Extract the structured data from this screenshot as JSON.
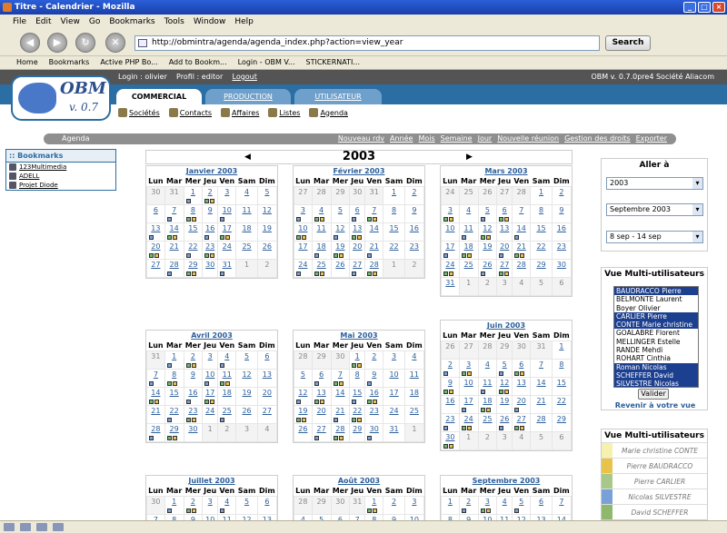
{
  "window": {
    "title": "Titre - Calendrier - Mozilla"
  },
  "menu": [
    "File",
    "Edit",
    "View",
    "Go",
    "Bookmarks",
    "Tools",
    "Window",
    "Help"
  ],
  "url": "http://obmintra/agenda/agenda_index.php?action=view_year",
  "search_label": "Search",
  "bookmark_bar": [
    "Home",
    "Bookmarks",
    "Active PHP Bo...",
    "Add to Bookm...",
    "Login - OBM V...",
    "STICKERNATI..."
  ],
  "topstrip": {
    "login": "Login : olivier",
    "profil": "Profil : editor",
    "logout": "Logout",
    "version": "OBM v. 0.7.0pre4 Société Aliacom"
  },
  "logo": {
    "name": "OBM",
    "version": "v. 0.7"
  },
  "tabs": [
    "COMMERCIAL",
    "PRODUCTION",
    "UTILISATEUR"
  ],
  "subnav": [
    "Sociétés",
    "Contacts",
    "Affaires",
    "Listes",
    "Agenda"
  ],
  "agendabar": {
    "label": "Agenda",
    "links": [
      "Nouveau rdv",
      "Année",
      "Mois",
      "Semaine",
      "Jour",
      "Nouvelle réunion",
      "Gestion des droits",
      "Exporter"
    ]
  },
  "bookmarks": {
    "title": ":: Bookmarks",
    "items": [
      "123Multimedia",
      "ADELL",
      "Projet Diode"
    ]
  },
  "year": "2003",
  "dow": [
    "Lun",
    "Mar",
    "Mer",
    "Jeu",
    "Ven",
    "Sam",
    "Dim"
  ],
  "months": [
    {
      "name": "Janvier 2003",
      "weeks": [
        [
          "30",
          "31",
          "1",
          "2",
          "3",
          "4",
          "5"
        ],
        [
          "6",
          "7",
          "8",
          "9",
          "10",
          "11",
          "12"
        ],
        [
          "13",
          "14",
          "15",
          "16",
          "17",
          "18",
          "19"
        ],
        [
          "20",
          "21",
          "22",
          "23",
          "24",
          "25",
          "26"
        ],
        [
          "27",
          "28",
          "29",
          "30",
          "31",
          "1",
          "2"
        ]
      ]
    },
    {
      "name": "Février 2003",
      "weeks": [
        [
          "27",
          "28",
          "29",
          "30",
          "31",
          "1",
          "2"
        ],
        [
          "3",
          "4",
          "5",
          "6",
          "7",
          "8",
          "9"
        ],
        [
          "10",
          "11",
          "12",
          "13",
          "14",
          "15",
          "16"
        ],
        [
          "17",
          "18",
          "19",
          "20",
          "21",
          "22",
          "23"
        ],
        [
          "24",
          "25",
          "26",
          "27",
          "28",
          "1",
          "2"
        ]
      ]
    },
    {
      "name": "Mars 2003",
      "weeks": [
        [
          "24",
          "25",
          "26",
          "27",
          "28",
          "1",
          "2"
        ],
        [
          "3",
          "4",
          "5",
          "6",
          "7",
          "8",
          "9"
        ],
        [
          "10",
          "11",
          "12",
          "13",
          "14",
          "15",
          "16"
        ],
        [
          "17",
          "18",
          "19",
          "20",
          "21",
          "22",
          "23"
        ],
        [
          "24",
          "25",
          "26",
          "27",
          "28",
          "29",
          "30"
        ],
        [
          "31",
          "1",
          "2",
          "3",
          "4",
          "5",
          "6"
        ]
      ]
    },
    {
      "name": "Avril 2003",
      "weeks": [
        [
          "31",
          "1",
          "2",
          "3",
          "4",
          "5",
          "6"
        ],
        [
          "7",
          "8",
          "9",
          "10",
          "11",
          "12",
          "13"
        ],
        [
          "14",
          "15",
          "16",
          "17",
          "18",
          "19",
          "20"
        ],
        [
          "21",
          "22",
          "23",
          "24",
          "25",
          "26",
          "27"
        ],
        [
          "28",
          "29",
          "30",
          "1",
          "2",
          "3",
          "4"
        ]
      ]
    },
    {
      "name": "Mai 2003",
      "weeks": [
        [
          "28",
          "29",
          "30",
          "1",
          "2",
          "3",
          "4"
        ],
        [
          "5",
          "6",
          "7",
          "8",
          "9",
          "10",
          "11"
        ],
        [
          "12",
          "13",
          "14",
          "15",
          "16",
          "17",
          "18"
        ],
        [
          "19",
          "20",
          "21",
          "22",
          "23",
          "24",
          "25"
        ],
        [
          "26",
          "27",
          "28",
          "29",
          "30",
          "31",
          "1"
        ]
      ]
    },
    {
      "name": "Juin 2003",
      "weeks": [
        [
          "26",
          "27",
          "28",
          "29",
          "30",
          "31",
          "1"
        ],
        [
          "2",
          "3",
          "4",
          "5",
          "6",
          "7",
          "8"
        ],
        [
          "9",
          "10",
          "11",
          "12",
          "13",
          "14",
          "15"
        ],
        [
          "16",
          "17",
          "18",
          "19",
          "20",
          "21",
          "22"
        ],
        [
          "23",
          "24",
          "25",
          "26",
          "27",
          "28",
          "29"
        ],
        [
          "30",
          "1",
          "2",
          "3",
          "4",
          "5",
          "6"
        ]
      ]
    },
    {
      "name": "Juillet 2003",
      "weeks": [
        [
          "30",
          "1",
          "2",
          "3",
          "4",
          "5",
          "6"
        ],
        [
          "7",
          "8",
          "9",
          "10",
          "11",
          "12",
          "13"
        ]
      ]
    },
    {
      "name": "Août 2003",
      "weeks": [
        [
          "28",
          "29",
          "30",
          "31",
          "1",
          "2",
          "3"
        ],
        [
          "4",
          "5",
          "6",
          "7",
          "8",
          "9",
          "10"
        ]
      ]
    },
    {
      "name": "Septembre 2003",
      "weeks": [
        [
          "1",
          "2",
          "3",
          "4",
          "5",
          "6",
          "7"
        ],
        [
          "8",
          "9",
          "10",
          "11",
          "12",
          "13",
          "14"
        ]
      ]
    }
  ],
  "goto": {
    "title": "Aller à",
    "year": "2003",
    "month": "Septembre 2003",
    "week": "8 sep - 14 sep"
  },
  "multi": {
    "title": "Vue Multi-utilisateurs",
    "users": [
      "BAUDRACCO Pierre",
      "BELMONTE Laurent",
      "Boyer Olivier",
      "CARLIER Pierre",
      "CONTE Marie christine",
      "GOALABRE Florent",
      "MELLINGER Estelle",
      "RANDE Mehdi",
      "ROHART Cinthia",
      "Roman Nicolas",
      "SCHEFFER David",
      "SILVESTRE Nicolas"
    ],
    "selected": [
      0,
      3,
      4,
      9,
      10,
      11
    ],
    "valider": "Valider",
    "revenir": "Revenir à votre vue"
  },
  "legend": {
    "title": "Vue Multi-utilisateurs",
    "items": [
      {
        "name": "Marie christine CONTE",
        "color": "#f7f1b0"
      },
      {
        "name": "Pierre BAUDRACCO",
        "color": "#e8c24a"
      },
      {
        "name": "Pierre CARLIER",
        "color": "#a8c88a"
      },
      {
        "name": "Nicolas SILVESTRE",
        "color": "#7aa0d8"
      },
      {
        "name": "David SCHEFFER",
        "color": "#8fb86f"
      }
    ]
  }
}
